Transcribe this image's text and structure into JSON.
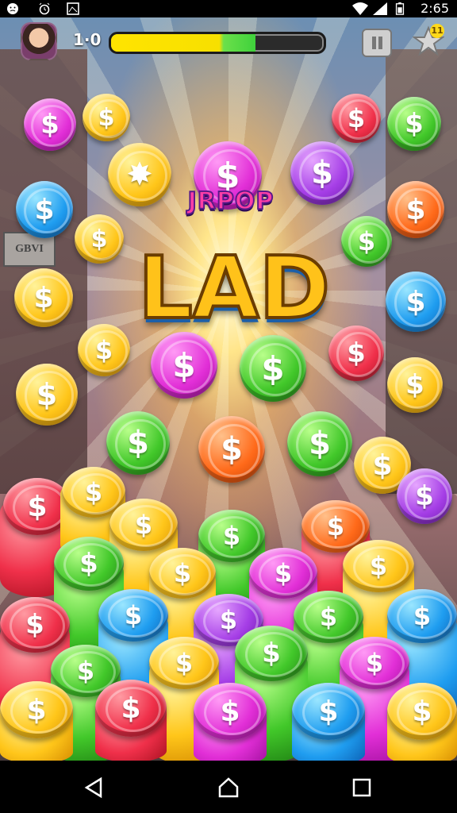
{
  "status_bar": {
    "time": "2:65",
    "icons": [
      "emoji-face-icon",
      "alarm-icon",
      "image-icon",
      "wifi-icon",
      "signal-icon",
      "battery-icon"
    ]
  },
  "hud": {
    "score": "1·0",
    "progress_fraction": 0.68,
    "star_badge": "11",
    "pause_icon": "pause-icon",
    "star_icon": "star-icon",
    "avatar_icon": "avatar"
  },
  "title": {
    "small": "JRPOP",
    "big": "LAD"
  },
  "sign_text": "GBVI",
  "coin_colors": {
    "magenta": "#e22fd7",
    "gold": "#ffc61a",
    "red": "#f0304a",
    "green": "#42c82a",
    "blue": "#1f9df0",
    "purple": "#a53ee6",
    "orange": "#ff6a1a"
  },
  "nav": {
    "back_icon": "back-triangle-icon",
    "home_icon": "home-icon",
    "recents_icon": "recents-square-icon"
  }
}
